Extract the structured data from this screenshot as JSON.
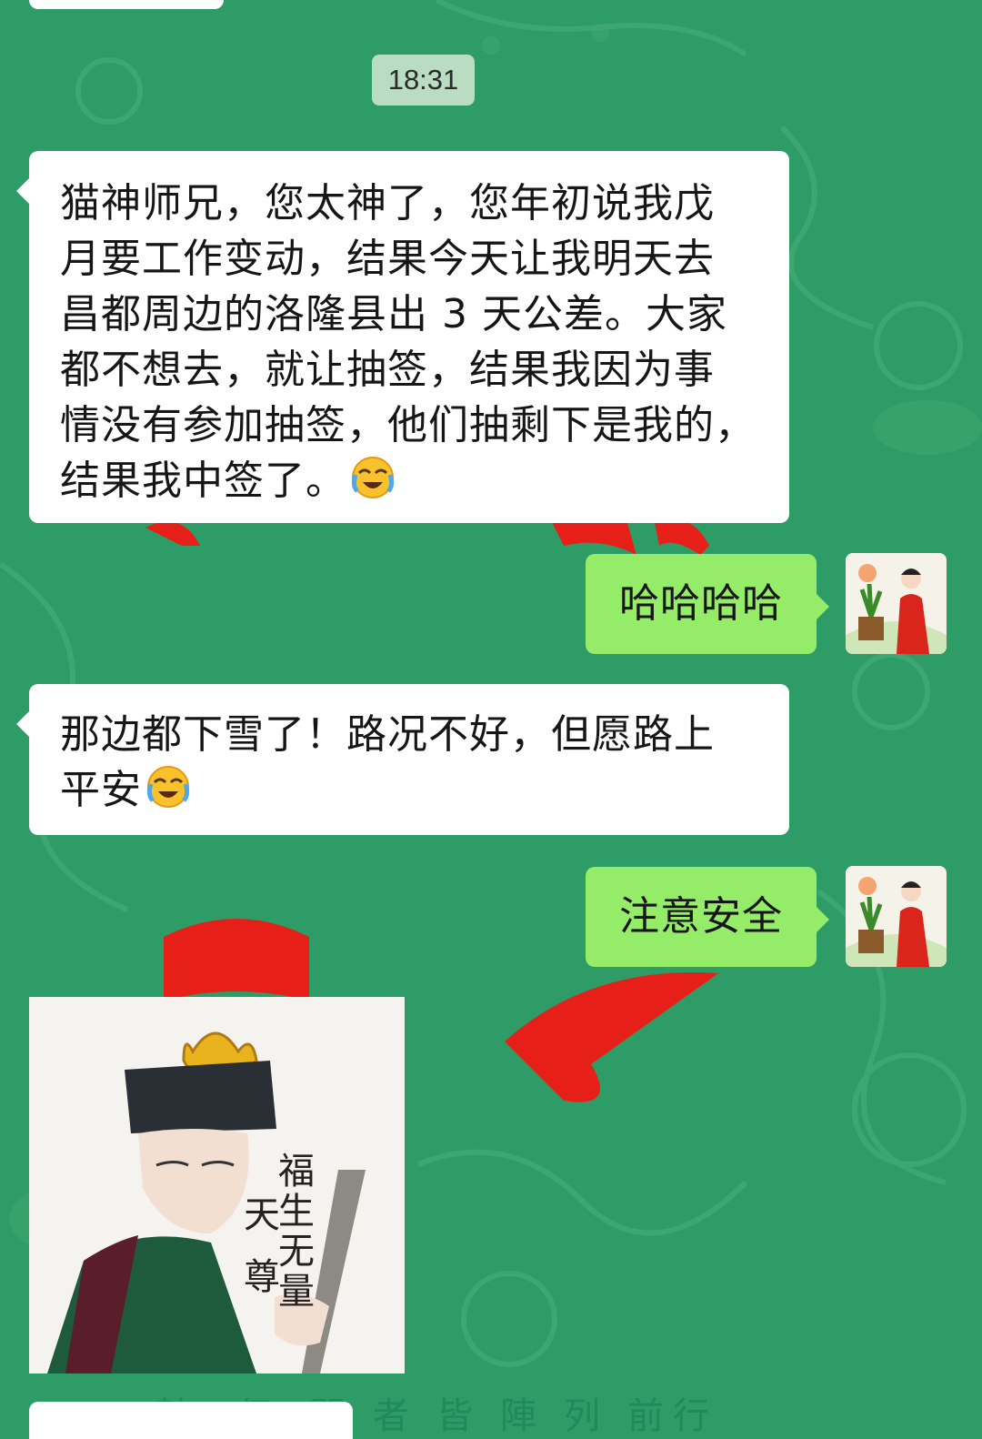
{
  "chat": {
    "timestamp": "18:31",
    "messages": [
      {
        "direction": "incoming",
        "lines": [
          "猫神师兄，您太神了，您年初说我戊",
          "月要工作变动，结果今天让我明天去",
          "昌都周边的洛隆县出 3 天公差。大家",
          "都不想去，就让抽签，结果我因为事",
          "情没有参加抽签，他们抽剩下是我的，",
          "结果我中签了。"
        ],
        "emoji": "sweat-smile-emoji"
      },
      {
        "direction": "outgoing",
        "text": "哈哈哈哈",
        "avatar": "user-avatar"
      },
      {
        "direction": "incoming",
        "lines": [
          "那边都下雪了！路况不好，但愿路上",
          "平安"
        ],
        "emoji": "sweat-smile-emoji"
      },
      {
        "direction": "outgoing",
        "text": "注意安全",
        "avatar": "user-avatar"
      },
      {
        "direction": "incoming",
        "type": "sticker",
        "sticker": {
          "left_column": "天尊",
          "right_column": "福生无量"
        }
      }
    ]
  },
  "colors": {
    "chat_background": "#2e9c66",
    "incoming_bubble": "#ffffff",
    "outgoing_bubble": "#95ec69",
    "timestamp_chip": "#b9dcc2"
  }
}
